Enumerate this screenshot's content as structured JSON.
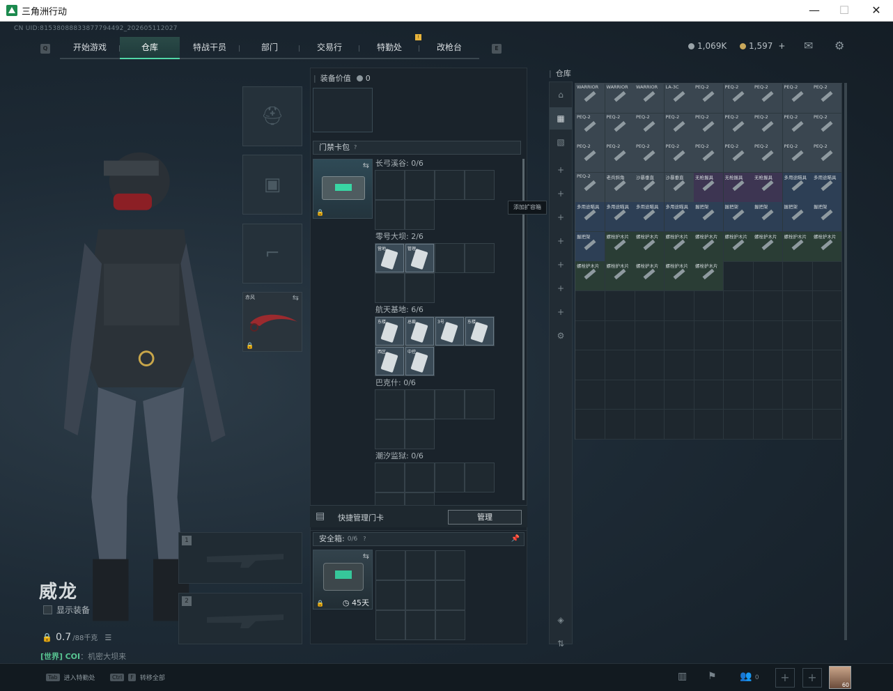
{
  "window": {
    "title": "三角洲行动",
    "controls": [
      "—",
      "☐",
      "✕"
    ]
  },
  "uid": "CN UID:81538088833877794492_202605112027",
  "nav": {
    "tabs": [
      {
        "label": "开始游戏",
        "active": false
      },
      {
        "label": "仓库",
        "active": true
      },
      {
        "label": "特战干员",
        "active": false
      },
      {
        "label": "部门",
        "active": false
      },
      {
        "label": "交易行",
        "active": false
      },
      {
        "label": "特勤处",
        "active": false
      },
      {
        "label": "改枪台",
        "active": false
      }
    ],
    "left_key": "Q",
    "right_key": "E",
    "badge": "!"
  },
  "currency": {
    "silver": "1,069K",
    "gold": "1,597",
    "add": "+"
  },
  "operator": {
    "name": "威龙",
    "show_equipment": "显示装备",
    "weight": "0.7",
    "weight_unit": "/88千克",
    "melee_label": "赤风",
    "weapon_slot_1": "1",
    "weapon_slot_2": "2"
  },
  "chat": {
    "channel": "[世界]",
    "name": "COI",
    "message": "：机密大坝来"
  },
  "equipment": {
    "title": "装备价值",
    "value": "0"
  },
  "keycard": {
    "title": "门禁卡包",
    "help": "?",
    "add_container_tooltip": "添加扩容箱",
    "groups": [
      {
        "label": "长弓溪谷: 0/6"
      },
      {
        "label": "零号大坝: 2/6"
      },
      {
        "label": "航天基地: 6/6"
      },
      {
        "label": "巴克什: 0/6"
      },
      {
        "label": "潮汐监狱: 0/6"
      }
    ],
    "dam_cards": [
      "营地",
      "管理"
    ],
    "space_cards": [
      "东楼",
      "总裁",
      "3号",
      "东楼",
      "西区",
      "中控"
    ],
    "quick_manage": "快捷管理门卡",
    "manage_button": "管理"
  },
  "safe_box": {
    "title": "安全箱:",
    "count": "0/6",
    "help": "?",
    "timer": "45天"
  },
  "stash": {
    "title": "仓库",
    "rows": [
      [
        {
          "t": "WARRIOR",
          "c": "gray"
        },
        {
          "t": "WARRIOR",
          "c": "gray"
        },
        {
          "t": "WARRIOR",
          "c": "gray"
        },
        {
          "t": "LA-3C",
          "c": "gray"
        },
        {
          "t": "PEQ-2",
          "c": "gray"
        },
        {
          "t": "PEQ-2",
          "c": "gray"
        },
        {
          "t": "PEQ-2",
          "c": "gray"
        },
        {
          "t": "PEQ-2",
          "c": "gray"
        },
        {
          "t": "PEQ-2",
          "c": "gray"
        }
      ],
      [
        {
          "t": "PEQ-2",
          "c": "gray"
        },
        {
          "t": "PEQ-2",
          "c": "gray"
        },
        {
          "t": "PEQ-2",
          "c": "gray"
        },
        {
          "t": "PEQ-2",
          "c": "gray"
        },
        {
          "t": "PEQ-2",
          "c": "gray"
        },
        {
          "t": "PEQ-2",
          "c": "gray"
        },
        {
          "t": "PEQ-2",
          "c": "gray"
        },
        {
          "t": "PEQ-2",
          "c": "gray"
        },
        {
          "t": "PEQ-2",
          "c": "gray"
        }
      ],
      [
        {
          "t": "PEQ-2",
          "c": "gray"
        },
        {
          "t": "PEQ-2",
          "c": "gray"
        },
        {
          "t": "PEQ-2",
          "c": "gray"
        },
        {
          "t": "PEQ-2",
          "c": "gray"
        },
        {
          "t": "PEQ-2",
          "c": "gray"
        },
        {
          "t": "PEQ-2",
          "c": "gray"
        },
        {
          "t": "PEQ-2",
          "c": "gray"
        },
        {
          "t": "PEQ-2",
          "c": "gray"
        },
        {
          "t": "PEQ-2",
          "c": "gray"
        }
      ],
      [
        {
          "t": "PEQ-2",
          "c": "gray"
        },
        {
          "t": "老兵斜角",
          "c": "gray"
        },
        {
          "t": "沙暴垂直",
          "c": "gray"
        },
        {
          "t": "沙暴垂直",
          "c": "gray"
        },
        {
          "t": "无枪握具",
          "c": "purple"
        },
        {
          "t": "无枪握具",
          "c": "purple"
        },
        {
          "t": "无枪握具",
          "c": "purple"
        },
        {
          "t": "多用途瞄具",
          "c": "blue"
        },
        {
          "t": "多用途瞄具",
          "c": "blue"
        }
      ],
      [
        {
          "t": "多用途瞄具",
          "c": "blue"
        },
        {
          "t": "多用途瞄具",
          "c": "blue"
        },
        {
          "t": "多用途瞄具",
          "c": "blue"
        },
        {
          "t": "多用途瞄具",
          "c": "blue"
        },
        {
          "t": "握把架",
          "c": "blue"
        },
        {
          "t": "握把架",
          "c": "blue"
        },
        {
          "t": "握把架",
          "c": "blue"
        },
        {
          "t": "握把架",
          "c": "blue"
        },
        {
          "t": "握把架",
          "c": "blue"
        }
      ],
      [
        {
          "t": "握把架",
          "c": "blue"
        },
        {
          "t": "螺栓护木片",
          "c": "green"
        },
        {
          "t": "螺栓护木片",
          "c": "green"
        },
        {
          "t": "螺栓护木片",
          "c": "green"
        },
        {
          "t": "螺栓护木片",
          "c": "green"
        },
        {
          "t": "螺栓护木片",
          "c": "green"
        },
        {
          "t": "螺栓护木片",
          "c": "green"
        },
        {
          "t": "螺栓护木片",
          "c": "green"
        },
        {
          "t": "螺栓护木片",
          "c": "green"
        }
      ],
      [
        {
          "t": "螺栓护木片",
          "c": "green"
        },
        {
          "t": "螺栓护木片",
          "c": "green"
        },
        {
          "t": "螺栓护木片",
          "c": "green"
        },
        {
          "t": "螺栓护木片",
          "c": "green"
        },
        {
          "t": "螺栓护木片",
          "c": "green"
        }
      ]
    ]
  },
  "bottom": {
    "hint_tab_key": "Tab",
    "hint_tab": "进入特勤处",
    "hint_ctrl_key": "Ctrl",
    "hint_f_key": "F",
    "hint_ctrl": "转移全部",
    "friends": "0",
    "level": "60"
  }
}
